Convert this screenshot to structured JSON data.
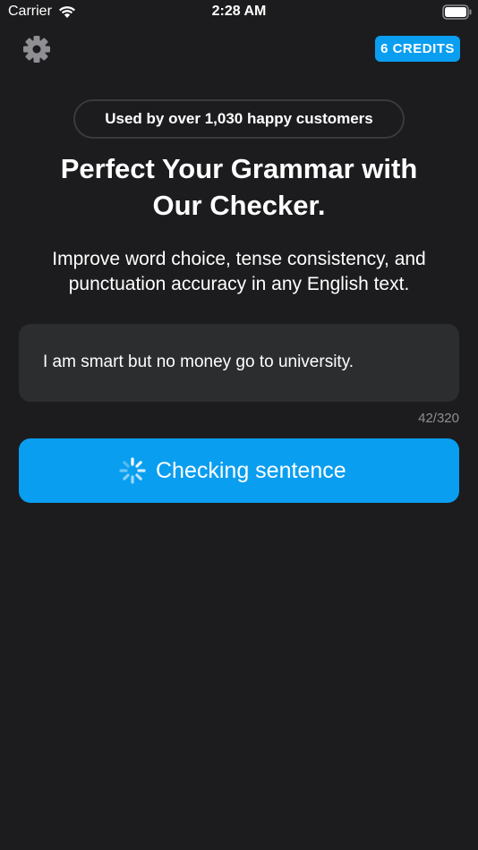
{
  "status_bar": {
    "carrier": "Carrier",
    "time": "2:28 AM"
  },
  "header": {
    "credits_label": "6 CREDITS"
  },
  "social_proof": "Used by over 1,030 happy customers",
  "headline": {
    "line1": "Perfect Your Grammar with",
    "line2": "Our Checker."
  },
  "subhead": {
    "line1": "Improve word choice, tense consistency, and",
    "line2": "punctuation accuracy in any English text."
  },
  "input": {
    "value": "I am smart but no money go to university.",
    "counter": "42/320"
  },
  "action": {
    "label": "Checking sentence"
  },
  "colors": {
    "background": "#1c1c1e",
    "accent": "#0a9ef0",
    "card": "#2c2d2f"
  }
}
